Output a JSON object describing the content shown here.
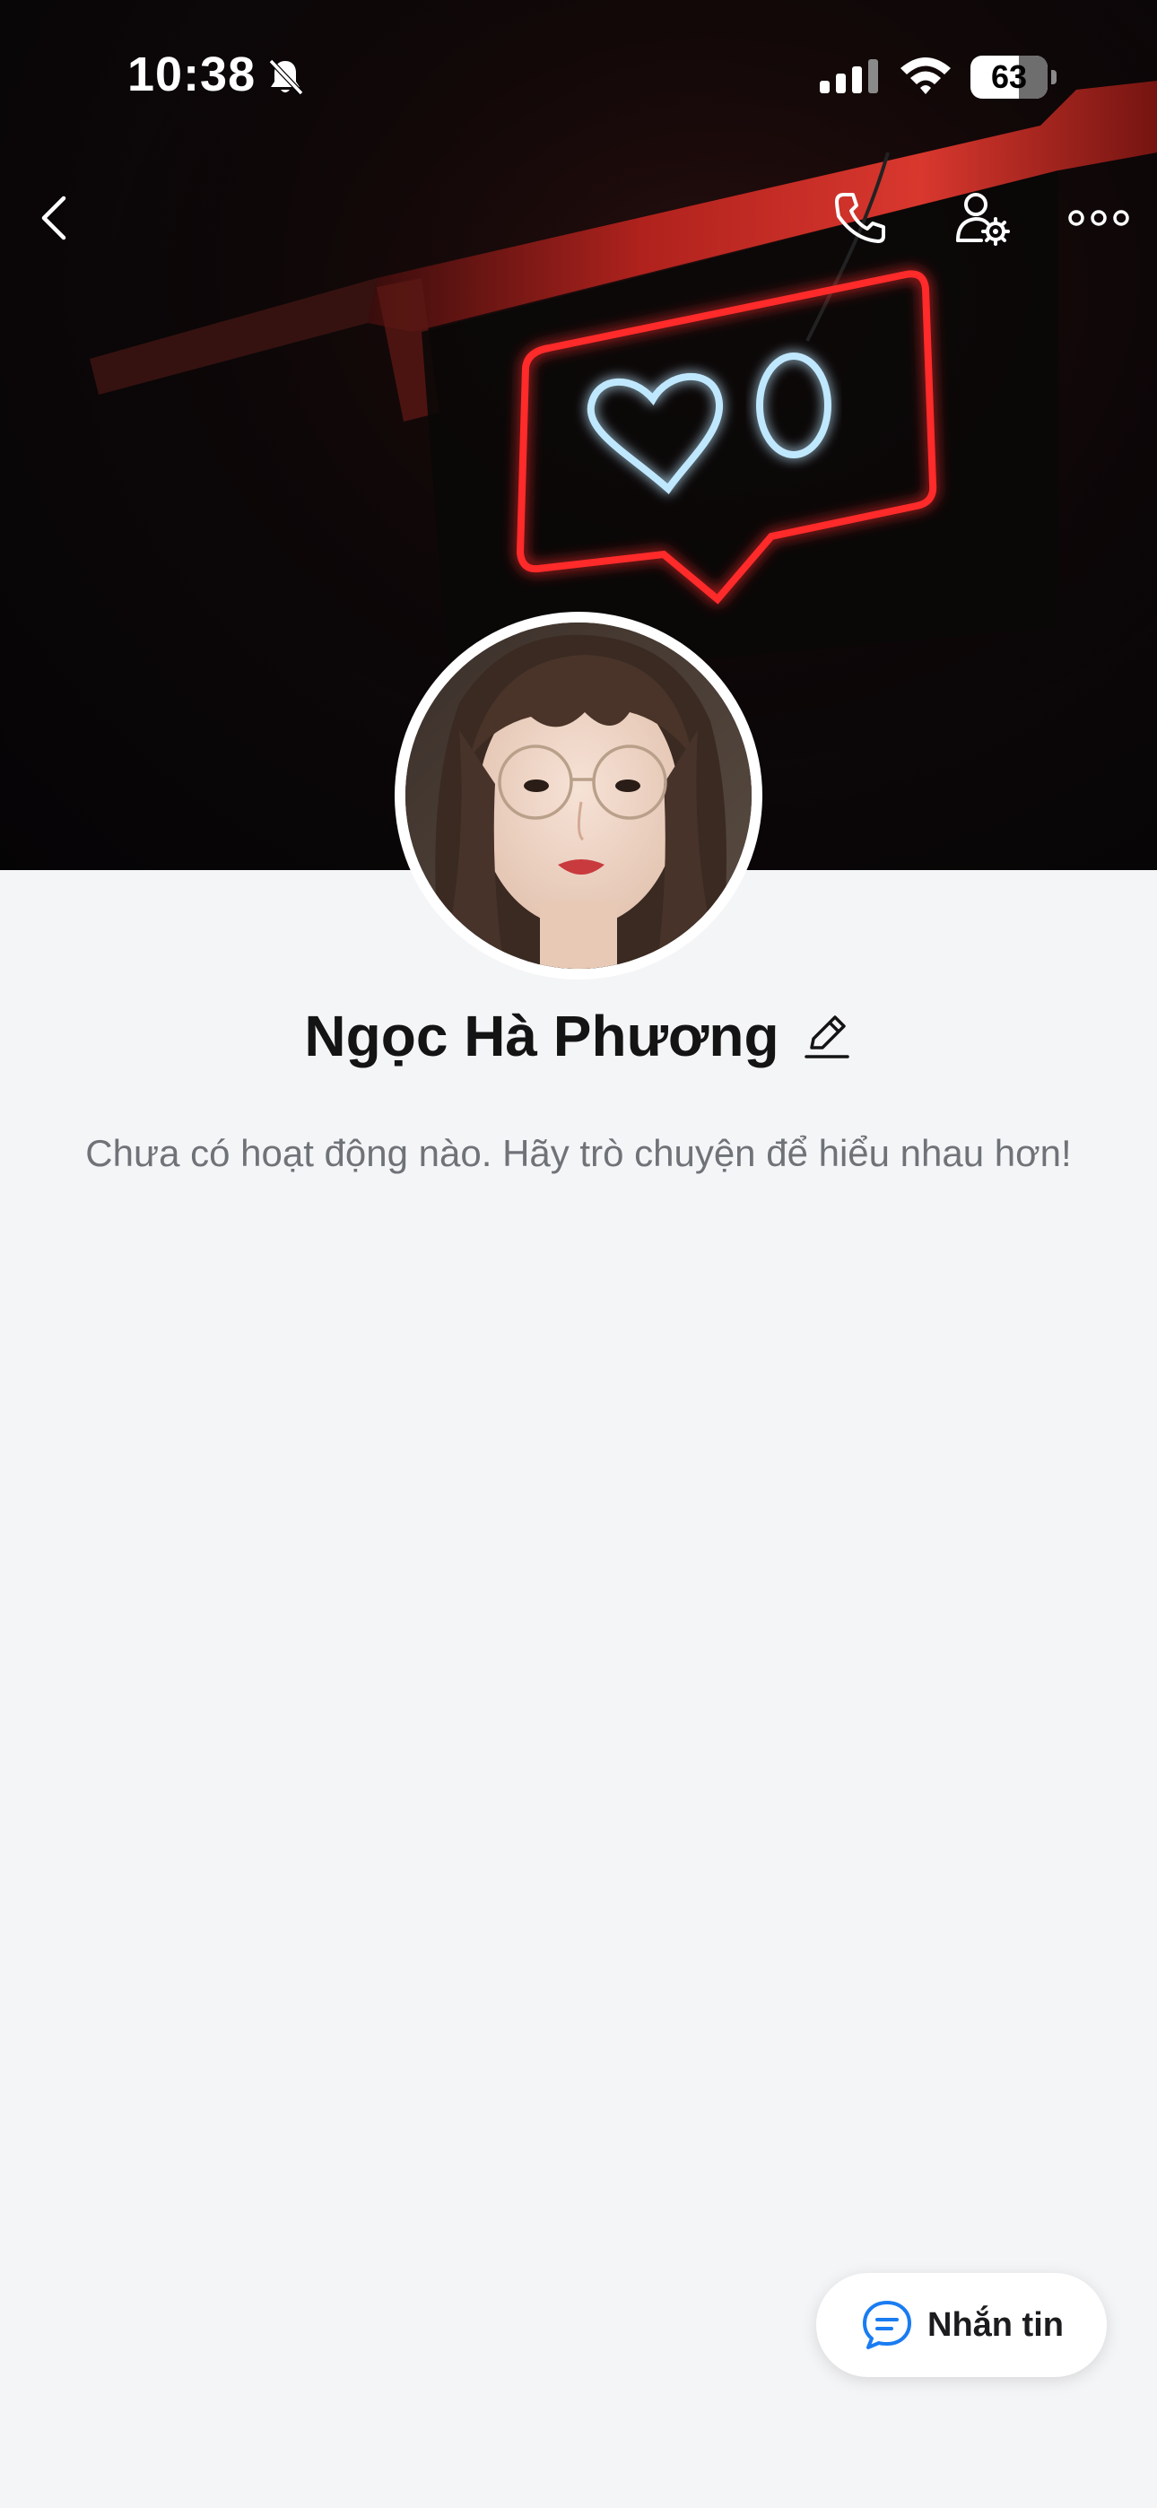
{
  "status_bar": {
    "time": "10:38",
    "battery_level": "63",
    "battery_fraction": 0.63,
    "icons": [
      "bell-off-icon",
      "signal-icon",
      "wifi-icon",
      "battery-icon"
    ]
  },
  "nav": {
    "icons": [
      "chevron-left-icon",
      "phone-icon",
      "user-settings-icon",
      "more-icon"
    ]
  },
  "profile": {
    "name": "Ngọc Hà Phương",
    "empty_activity": "Chưa có hoạt động nào. Hãy trò chuyện để hiểu nhau hơn!"
  },
  "actions": {
    "message_label": "Nhắn tin"
  },
  "colors": {
    "background": "#f4f5f7",
    "neon_red": "#ff2a2a",
    "neon_blue": "#bfe8ff",
    "accent_blue": "#1a7cf2"
  }
}
